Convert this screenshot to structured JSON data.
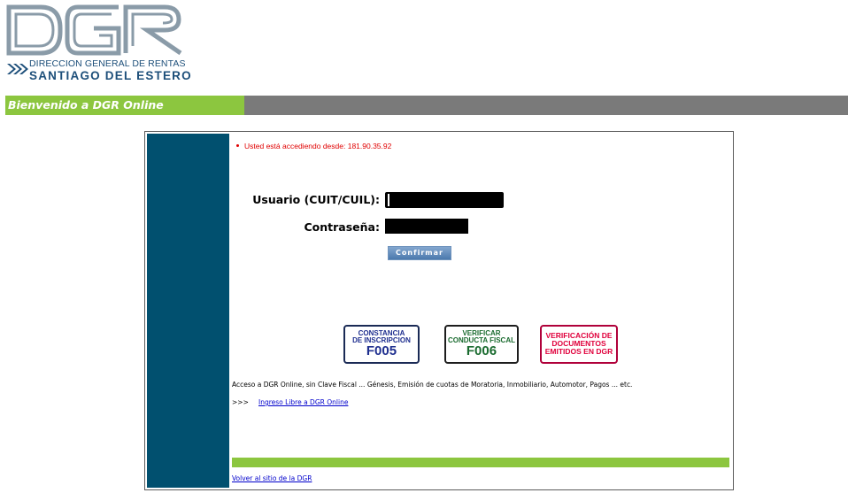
{
  "logo": {
    "letters": "DGR",
    "org_line1": "DIRECCION GENERAL DE RENTAS",
    "org_line2": "SANTIAGO DEL ESTERO",
    "icon": "chevron-arrows-icon"
  },
  "banner": {
    "title": "Bienvenido a DGR Online"
  },
  "warning": {
    "text": "Usted está accediendo desde: 181.90.35.92"
  },
  "login": {
    "user_label": "Usuario (CUIT/CUIL):",
    "user_value": "",
    "password_label": "Contraseña:",
    "password_value": "",
    "confirm_label": "Confirmar"
  },
  "badges": [
    {
      "line1": "CONSTANCIA",
      "line2": "DE INSCRIPCION",
      "code": "F005"
    },
    {
      "line1": "VERIFICAR",
      "line2": "CONDUCTA FISCAL",
      "code": "F006"
    },
    {
      "line1": "VERIFICACIÓN DE",
      "line2": "DOCUMENTOS",
      "line3": "EMITIDOS EN DGR"
    }
  ],
  "access": {
    "text": "Acceso a DGR Online, sin Clave Fiscal ... Génesis, Emisión de cuotas de Moratoria, Inmobiliario, Automotor, Pagos ... etc.",
    "arrows": ">>>",
    "link": "Ingreso Libre a DGR Online"
  },
  "footer": {
    "back_link": "Volver al sitio de la DGR"
  },
  "colors": {
    "sidebar": "#01506f",
    "accent_green": "#8cc63f",
    "banner_gray": "#7a7a7a",
    "warning_red": "#e00000",
    "link_blue": "#0000cc"
  }
}
